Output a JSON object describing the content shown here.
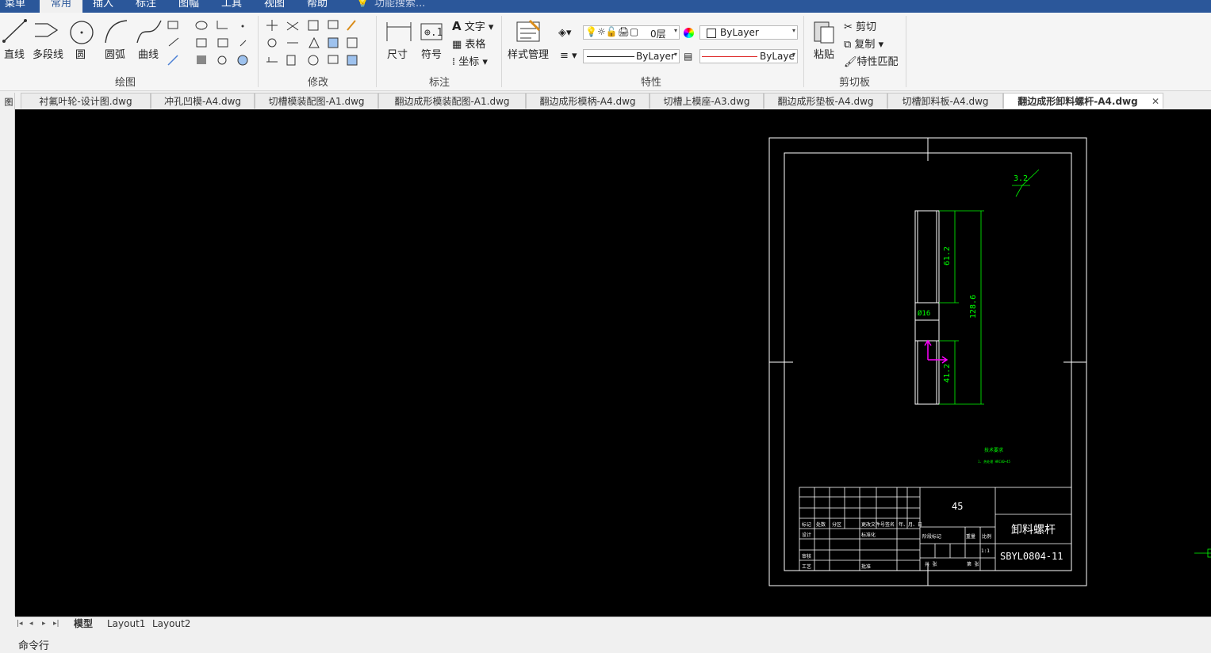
{
  "menu": [
    "菜单",
    "常用",
    "插入",
    "标注",
    "图幅",
    "工具",
    "视图",
    "帮助"
  ],
  "search_placeholder": "功能搜索...",
  "ribbon": {
    "draw": {
      "label": "绘图",
      "tools": [
        "直线",
        "多段线",
        "圆",
        "圆弧",
        "曲线"
      ]
    },
    "modify": {
      "label": "修改"
    },
    "annotate": {
      "label": "标注",
      "dim": "尺寸",
      "symbol": "符号",
      "text": "文字",
      "table": "表格",
      "coord": "坐标"
    },
    "style": {
      "label": "样式管理"
    },
    "props": {
      "label": "特性",
      "layer": "0层",
      "color": "ByLayer",
      "linetype": "ByLayer",
      "lineweight": "ByLayе"
    },
    "clipboard": {
      "label": "剪切板",
      "paste": "粘贴",
      "cut": "剪切",
      "copy": "复制",
      "match": "特性匹配"
    }
  },
  "tabs": [
    "衬氟叶轮-设计图.dwg",
    "冲孔凹模-A4.dwg",
    "切槽模装配图-A1.dwg",
    "翻边成形模装配图-A1.dwg",
    "翻边成形模柄-A4.dwg",
    "切槽上模座-A3.dwg",
    "翻边成形垫板-A4.dwg",
    "切槽卸料板-A4.dwg",
    "翻边成形卸料螺杆-A4.dwg"
  ],
  "active_tab": 8,
  "left_toolbar": "图",
  "drawing": {
    "roughness": "3.2",
    "dims": [
      "61.2",
      "128.6",
      "Ø16",
      "41.2"
    ],
    "tech_req": "技术要求",
    "tech_note": "1. 热处理 HRC40~45",
    "material": "45",
    "part_name": "卸料螺杆",
    "part_no": "SBYL0804-11",
    "scale": "1:1",
    "title_cells": [
      "标记",
      "处数",
      "分区",
      "更改文件号",
      "签名",
      "年、月、日",
      "设计",
      "标准化",
      "审核",
      "工艺",
      "批准",
      "阶段标记",
      "重量",
      "比例",
      "共 张",
      "第 张"
    ]
  },
  "layouts": [
    "模型",
    "Layout1",
    "Layout2"
  ],
  "command_label": "命令行",
  "colors": {
    "accent": "#2b579a",
    "canvas": "#000000",
    "dim": "#00ff00",
    "frame": "#ffffff",
    "ucs": "#ff00ff"
  }
}
